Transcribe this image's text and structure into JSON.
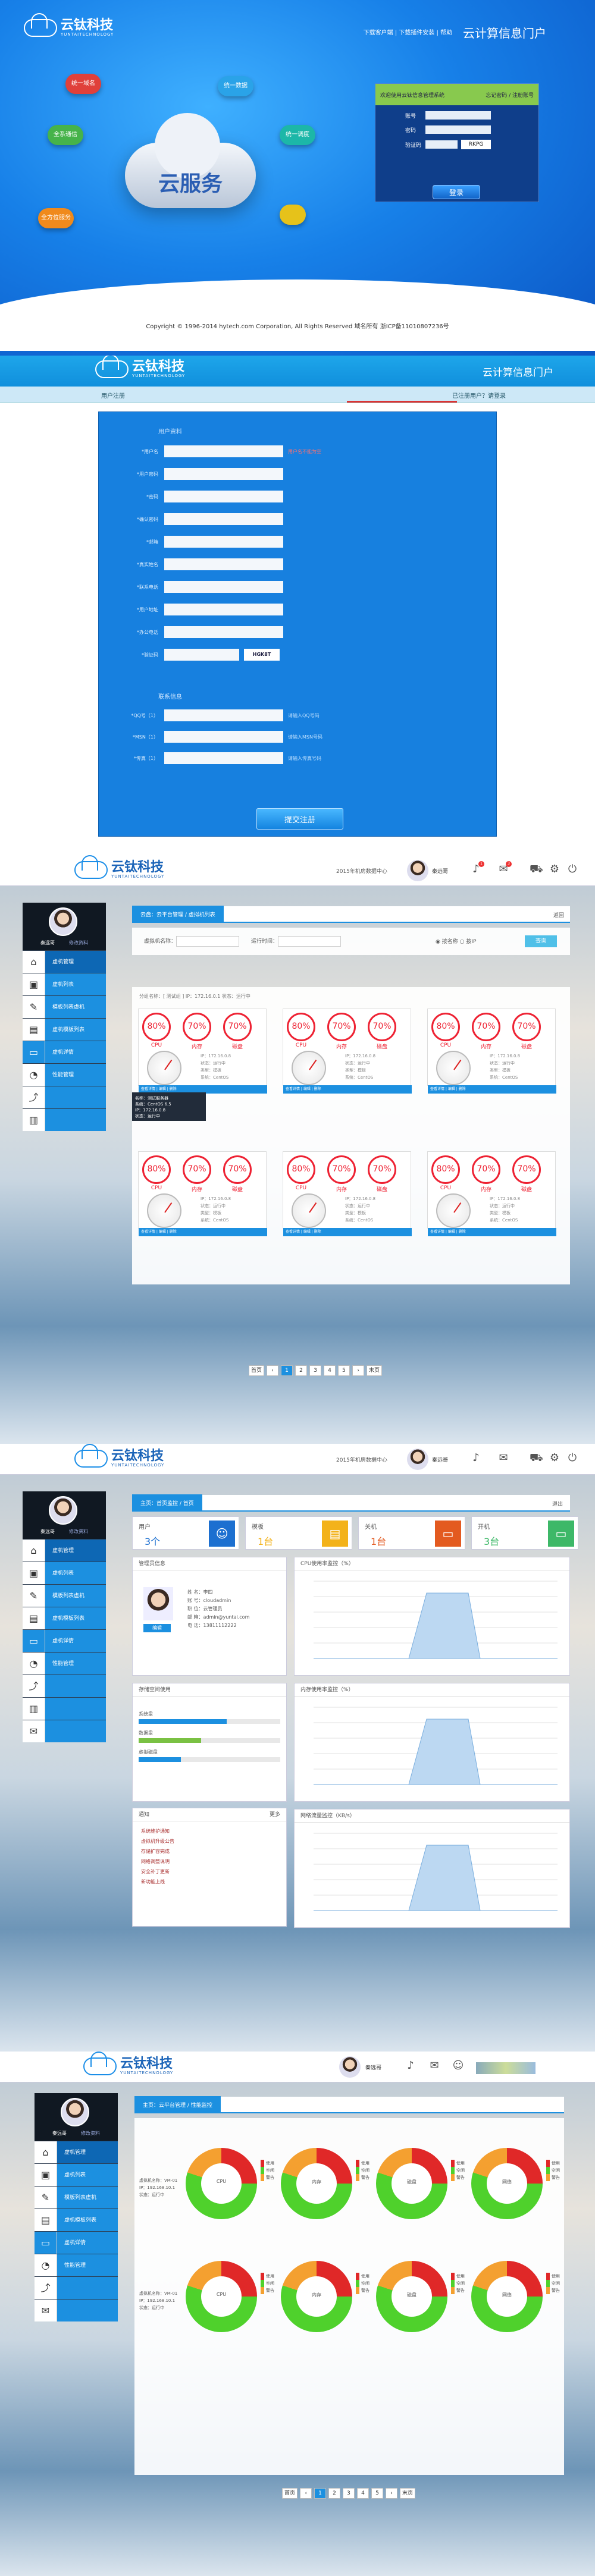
{
  "brand": {
    "name": "云钛科技",
    "en": "YUNTAITECHNOLOGY",
    "portal": "云计算信息门户"
  },
  "login_page": {
    "toplinks": "下载客户端 | 下载插件安装 | 帮助",
    "cloud_title": "云服务",
    "satellites": [
      "统一域名",
      "统一数据",
      "全系通信",
      "统一调度",
      "全方位服务"
    ],
    "login_header": "欢迎使用云钛信息管理系统",
    "login_header_right": "忘记密码 / 注册账号",
    "fields": [
      {
        "label": "账号",
        "value": ""
      },
      {
        "label": "密码",
        "value": ""
      },
      {
        "label": "验证码",
        "value": ""
      }
    ],
    "captcha": "RKPG",
    "login_button": "登录",
    "copyright": "Copyright © 1996-2014 hytech.com Corporation, All Rights Reserved 域名所有 浙ICP备11010807236号"
  },
  "register_page": {
    "sub_left": "用户注册",
    "sub_right": "已注册用户？请登录",
    "section1": "用户资料",
    "section2": "联系信息",
    "fields1": [
      {
        "label": "*用户名",
        "hint": "用户名不能为空"
      },
      {
        "label": "*用户密码",
        "hint": ""
      },
      {
        "label": "*密码",
        "hint": ""
      },
      {
        "label": "*确认密码",
        "hint": ""
      },
      {
        "label": "*邮箱",
        "hint": ""
      },
      {
        "label": "*真实姓名",
        "hint": ""
      },
      {
        "label": "*联系电话",
        "hint": ""
      },
      {
        "label": "*用户地址",
        "hint": ""
      },
      {
        "label": "*办公电话",
        "hint": ""
      },
      {
        "label": "*验证码",
        "hint": ""
      }
    ],
    "captcha": "HGK8T",
    "fields2": [
      {
        "label": "*QQ号（1）",
        "hint": "请输入QQ号码"
      },
      {
        "label": "*MSN（1）",
        "hint": "请输入MSN号码"
      },
      {
        "label": "*传真（1）",
        "hint": "请输入传真号码"
      }
    ],
    "submit": "提交注册"
  },
  "shared": {
    "top_title": "2015年机房数据中心",
    "username": "秦远哥",
    "logout": "退出",
    "side_user": "秦远哥",
    "side_role": "修改资料",
    "side_items": [
      "虚机管理",
      "虚机列表",
      "模板列表虚机",
      "虚机模板列表",
      "虚机详情",
      "性能管理"
    ]
  },
  "vm_list": {
    "crumb_label": "云盘：云平台管理 / 虚拟机列表",
    "filter": {
      "name_label": "虚拟机名称：",
      "date_label": "运行时间：",
      "radio1": "按名称",
      "radio2": "按IP",
      "query": "查询",
      "range": "运行时间",
      "back": "返回"
    },
    "group_title": "分组名称：[ 测试组 ]   IP：172.16.0.1   状态：运行中",
    "rings": [
      {
        "v": "80%",
        "l": "CPU"
      },
      {
        "v": "70%",
        "l": "内存"
      },
      {
        "v": "70%",
        "l": "磁盘"
      }
    ],
    "card_info": [
      "IP：172.16.0.8",
      "状态：运行中",
      "类型：模板",
      "系统：CentOS"
    ],
    "card_footer": "查看详情  |  编辑  |  删除",
    "tooltip": [
      "名称：测试服务器",
      "系统：CentOS 6.5",
      "IP：172.16.0.8",
      "状态：运行中"
    ],
    "pages": [
      "首页",
      "‹",
      "1",
      "2",
      "3",
      "4",
      "5",
      "›",
      "末页"
    ]
  },
  "dashboard": {
    "crumb_label": "主页：首页监控 / 首页",
    "stats": [
      {
        "label": "用户",
        "value": "3个",
        "color": "#1c6fd0",
        "icon": "user-icon"
      },
      {
        "label": "模板",
        "value": "1台",
        "color": "#f3b21a",
        "icon": "template-icon"
      },
      {
        "label": "关机",
        "value": "1台",
        "color": "#e35a20",
        "icon": "power-icon"
      },
      {
        "label": "开机",
        "value": "3台",
        "color": "#3db868",
        "icon": "monitor-icon"
      }
    ],
    "profile": {
      "title": "管理员信息",
      "lines": [
        "姓  名：李四",
        "账  号：cloudadmin",
        "职  位：云管理员",
        "邮  箱：admin@yuntai.com",
        "电  话：13811112222"
      ],
      "button": "编辑"
    },
    "storage": {
      "title": "存储空间使用",
      "items": [
        {
          "name": "系统盘",
          "pct": 0.62,
          "color": "#1c90e0"
        },
        {
          "name": "数据盘",
          "pct": 0.44,
          "color": "#7ac143"
        },
        {
          "name": "虚拟磁盘",
          "pct": 0.3,
          "color": "#1c90e0"
        }
      ]
    },
    "msg": {
      "title": "通知",
      "more": "更多",
      "items": [
        "系统维护通知",
        "虚拟机升级公告",
        "存储扩容完成",
        "网络调整说明",
        "安全补丁更新",
        "新功能上线"
      ]
    },
    "charts": [
      "CPU使用率监控（%）",
      "内存使用率监控（%）",
      "网络流量监控（KB/s）"
    ]
  },
  "perf": {
    "crumb_label": "主页：云平台管理 / 性能监控",
    "legend": [
      "使用",
      "空闲",
      "警告"
    ],
    "donut_labels": [
      "CPU",
      "内存",
      "磁盘",
      "网络"
    ],
    "rowinfo": [
      "虚拟机名称：VM-01",
      "IP：192.168.10.1",
      "状态：运行中"
    ],
    "pages": [
      "首页",
      "‹",
      "1",
      "2",
      "3",
      "4",
      "5",
      "›",
      "末页"
    ]
  }
}
